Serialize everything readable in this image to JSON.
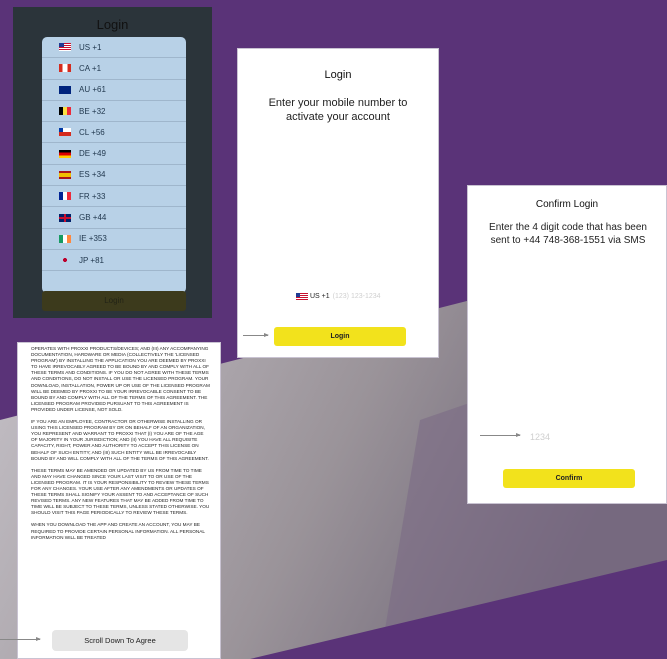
{
  "panel1": {
    "title": "Login",
    "countries": [
      {
        "label": "US +1",
        "flag": "us"
      },
      {
        "label": "CA +1",
        "flag": "ca"
      },
      {
        "label": "AU +61",
        "flag": "au"
      },
      {
        "label": "BE +32",
        "flag": "be"
      },
      {
        "label": "CL +56",
        "flag": "cl"
      },
      {
        "label": "DE +49",
        "flag": "de"
      },
      {
        "label": "ES +34",
        "flag": "es"
      },
      {
        "label": "FR +33",
        "flag": "fr"
      },
      {
        "label": "GB +44",
        "flag": "gb"
      },
      {
        "label": "IE +353",
        "flag": "ie"
      },
      {
        "label": "JP +81",
        "flag": "jp"
      }
    ],
    "button_label": "Login"
  },
  "panel2": {
    "title": "Login",
    "subtitle": "Enter your mobile number to activate your account",
    "country_code": "US +1",
    "phone_placeholder": "(123) 123-1234",
    "button_label": "Login"
  },
  "panel3": {
    "title": "Confirm Login",
    "subtitle": "Enter the 4 digit code that has been sent to +44 748-368-1551 via SMS",
    "code_placeholder": "1234",
    "button_label": "Confirm"
  },
  "panel4": {
    "paragraphs": [
      "OPERATES WITH PROXXI PRODUCTS/DEVICES; AND (III) ANY ACCOMPANYING DOCUMENTATION, HARDWARE OR MEDIA (COLLECTIVELY THE 'LICENSED PROGRAM') BY INSTALLING THE APPLICATION YOU ARE DEEMED BY PROXXI TO HAVE IRREVOCABLY AGREED TO BE BOUND BY AND COMPLY WITH ALL OF THESE TERMS AND CONDITIONS. IF YOU DO NOT AGREE WITH THESE TERMS AND CONDITIONS, DO NOT INSTALL OR USE THE LICENSED PROGRAM. YOUR DOWNLOAD, INSTALLATION, POWER UP OR USE OF THE LICENSED PROGRAM WILL BE DEEMED BY PROXXI TO BE YOUR IRREVOCABLE CONSENT TO BE BOUND BY AND COMPLY WITH ALL OF THE TERMS OF THIS AGREEMENT. THE LICENSED PROGRAM PROVIDED PURSUANT TO THIS AGREEMENT IS PROVIDED UNDER LICENSE, NOT SOLD.",
      "IF YOU ARE AN EMPLOYEE, CONTRACTOR OR OTHERWISE INSTALLING OR USING THIS LICENSED PROGRAM BY OR ON BEHALF OF AN ORGANIZATION, YOU REPRESENT AND WARRANT TO PROXXI THAT (I) YOU ARE OF THE AGE OF MAJORITY IN YOUR JURISDICTION; AND (II) YOU HAVE ALL REQUISITE CAPACITY, RIGHT, POWER AND AUTHORITY TO ACCEPT THIS LICENSE ON BEHALF OF SUCH ENTITY; AND (III) SUCH ENTITY WILL BE IRREVOCABLY BOUND BY AND WILL COMPLY WITH ALL OF THE TERMS OF THIS AGREEMENT.",
      "THESE TERMS MAY BE AMENDED OR UPDATED BY US FROM TIME TO TIME AND MAY HAVE CHANGED SINCE YOUR LAST VISIT TO OR USE OF THE LICENSED PROGRAM. IT IS YOUR RESPONSIBILITY TO REVIEW THESE TERMS FOR ANY CHANGES. YOUR USE AFTER ANY AMENDMENTS OR UPDATES OF THESE TERMS SHALL SIGNIFY YOUR ASSENT TO AND ACCEPTANCE OF SUCH REVISED TERMS. ANY NEW FEATURES THAT MAY BE ADDED FROM TIME TO TIME WILL BE SUBJECT TO THESE TERMS, UNLESS STATED OTHERWISE. YOU SHOULD VISIT THIS PAGE PERIODICALLY TO REVIEW THESE TERMS.",
      "WHEN YOU DOWNLOAD THE APP AND CREATE AN ACCOUNT, YOU MAY BE REQUIRED TO PROVIDE CERTAIN PERSONAL INFORMATION. ALL PERSONAL INFORMATION WILL BE TREATED"
    ],
    "button_label": "Scroll Down To Agree"
  },
  "colors": {
    "background": "#5a3378",
    "accent_yellow": "#f2e21c",
    "list_blue": "#b8d1e7"
  }
}
